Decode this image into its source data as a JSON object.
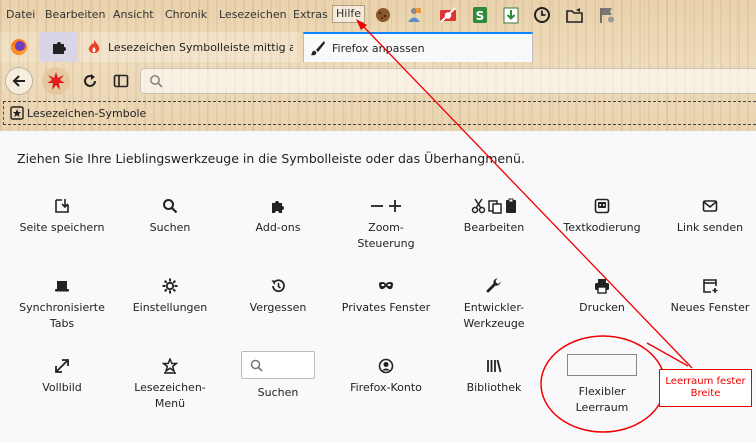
{
  "menubar": {
    "items": [
      "Datei",
      "Bearbeiten",
      "Ansicht",
      "Chronik",
      "Lesezeichen",
      "Extras",
      "Hilfe"
    ],
    "active": "Hilfe"
  },
  "extensions": [
    "cookie-extension-icon",
    "puzzle-person-icon",
    "camera-off-icon",
    "script-s-icon",
    "download-doc-icon",
    "clock-icon",
    "folder-export-icon",
    "flag-gear-icon"
  ],
  "tabs": {
    "tab1": {
      "label": "Lesezeichen Symbolleiste mittig an"
    },
    "tab2": {
      "label": "Firefox anpassen"
    }
  },
  "bookmarks": {
    "label": "Lesezeichen-Symbole"
  },
  "heading": "Ziehen Sie Ihre Lieblingswerkzeuge in die Symbolleiste oder das Überhangmenü.",
  "items": {
    "row1": [
      "Seite speichern",
      "Suchen",
      "Add-ons",
      "Zoom-\nSteuerung",
      "Bearbeiten",
      "Textkodierung",
      "Link senden"
    ],
    "row2": [
      "Synchronisierte\nTabs",
      "Einstellungen",
      "Vergessen",
      "Privates Fenster",
      "Entwickler-\nWerkzeuge",
      "Drucken",
      "Neues Fenster"
    ],
    "row3": [
      "Vollbild",
      "Lesezeichen-\nMenü",
      "Suchen",
      "Firefox-Konto",
      "Bibliothek",
      "Flexibler\nLeerraum"
    ]
  },
  "annotation": {
    "text": "Leerraum fester Breite",
    "color": "#e00000"
  },
  "colors": {
    "accent": "#0a84ff",
    "annotation": "#e00000"
  }
}
